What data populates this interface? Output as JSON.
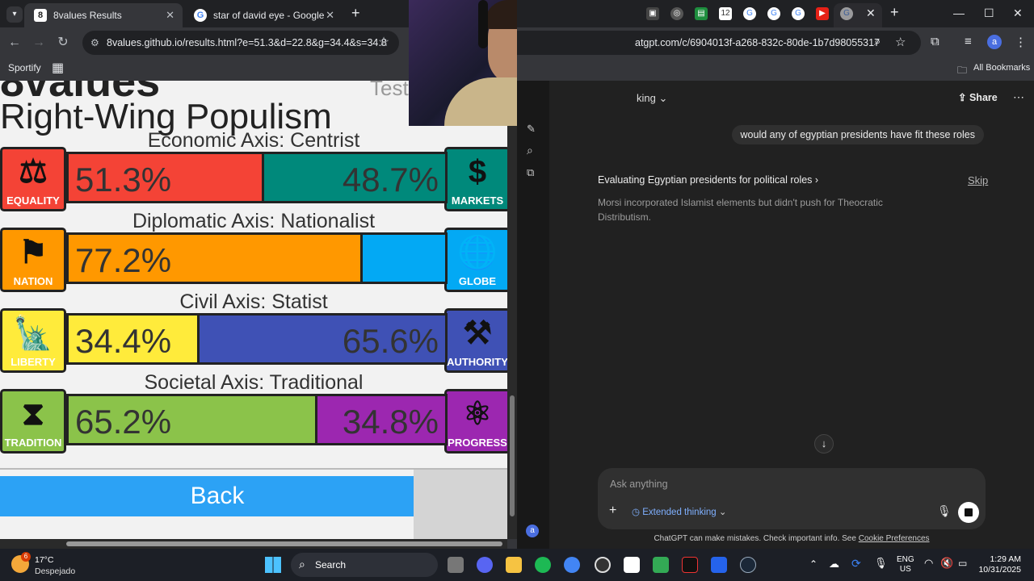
{
  "left_browser": {
    "tabs": [
      {
        "title": "8values Results",
        "favicon": "8",
        "active": true
      },
      {
        "title": "star of david eye - Google Sear",
        "favicon": "G",
        "active": false
      }
    ],
    "url": "8values.github.io/results.html?e=51.3&d=22.8&g=34.4&s=34.8",
    "bookmarks": [
      {
        "label": "Sportify"
      }
    ]
  },
  "page": {
    "title_cut": "8values",
    "test_cut": "Test",
    "ideology": "Right-Wing Populism",
    "axes": [
      {
        "label": "Economic Axis: Centrist",
        "left_name": "EQUALITY",
        "right_name": "MARKETS",
        "left_value": 51.3,
        "right_value": 48.7,
        "left_text": "51.3%",
        "right_text": "48.7%",
        "left_color": "#f44336",
        "right_color": "#00897b",
        "left_icon": "scales-icon",
        "right_icon": "dollar-icon"
      },
      {
        "label": "Diplomatic Axis: Nationalist",
        "left_name": "NATION",
        "right_name": "GLOBE",
        "left_value": 77.2,
        "right_value": 22.8,
        "left_text": "77.2%",
        "right_text": "",
        "left_color": "#ff9800",
        "right_color": "#03a9f4",
        "left_icon": "flag-icon",
        "right_icon": "globe-icon"
      },
      {
        "label": "Civil Axis: Statist",
        "left_name": "LIBERTY",
        "right_name": "AUTHORITY",
        "left_value": 34.4,
        "right_value": 65.6,
        "left_text": "34.4%",
        "right_text": "65.6%",
        "left_color": "#ffeb3b",
        "right_color": "#3f51b5",
        "left_icon": "statue-of-liberty-icon",
        "right_icon": "gavel-icon"
      },
      {
        "label": "Societal Axis: Traditional",
        "left_name": "TRADITION",
        "right_name": "PROGRESS",
        "left_value": 65.2,
        "right_value": 34.8,
        "left_text": "65.2%",
        "right_text": "34.8%",
        "left_color": "#8bc34a",
        "right_color": "#9c27b0",
        "left_icon": "hourglass-icon",
        "right_icon": "atom-icon"
      }
    ],
    "back_label": "Back"
  },
  "right_browser": {
    "url": "atgpt.com/c/6904013f-a268-832c-80de-1b7d98055317",
    "bookmarks_label": "All Bookmarks",
    "model_label": "king",
    "share_label": "Share",
    "user_message": "would any of egyptian presidents have fit these roles",
    "thinking_title": "Evaluating Egyptian presidents for political roles",
    "skip_label": "Skip",
    "thinking_text": "Morsi incorporated Islamist elements but didn't push for Theocratic Distributism.",
    "composer_placeholder": "Ask anything",
    "extended_thinking_label": "Extended thinking",
    "footnote": "ChatGPT can make mistakes. Check important info. See",
    "footnote_link": "Cookie Preferences",
    "avatar_letter": "a"
  },
  "taskbar": {
    "weather_temp": "17°C",
    "weather_desc": "Despejado",
    "weather_badge": "6",
    "search_label": "Search",
    "lang": "ENG",
    "region": "US",
    "time": "1:29 AM",
    "date": "10/31/2025"
  }
}
